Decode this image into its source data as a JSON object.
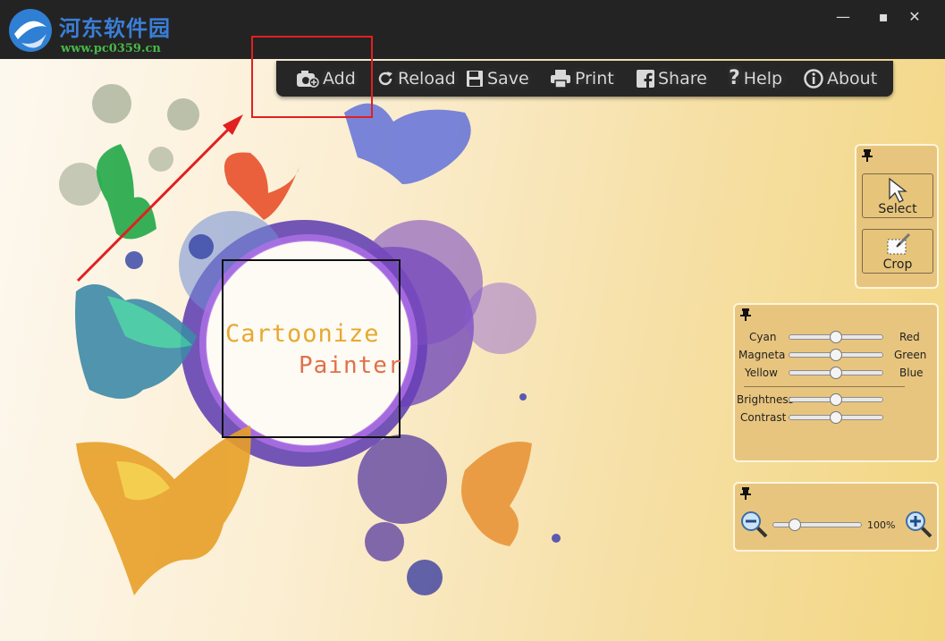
{
  "watermark": {
    "title": "河东软件园",
    "url": "www.pc0359.cn"
  },
  "window": {
    "minimize": "—",
    "maximize": "▪",
    "close": "✕"
  },
  "toolbar": {
    "add": "Add",
    "reload": "Reload",
    "save": "Save",
    "print": "Print",
    "share": "Share",
    "help": "Help",
    "about": "About"
  },
  "tools": {
    "select": "Select",
    "crop": "Crop"
  },
  "color_panel": {
    "cyan": "Cyan",
    "red": "Red",
    "magenta": "Magneta",
    "green": "Green",
    "yellow": "Yellow",
    "blue": "Blue",
    "brightness": "Brightness",
    "contrast": "Contrast"
  },
  "zoom": {
    "value": "100%"
  },
  "artwork": {
    "line1": "Cartoonize",
    "line2": "Painter"
  },
  "colors": {
    "accent_red": "#e12020",
    "toolbar_bg": "#262626",
    "panel_bg": "#e8c57e"
  }
}
